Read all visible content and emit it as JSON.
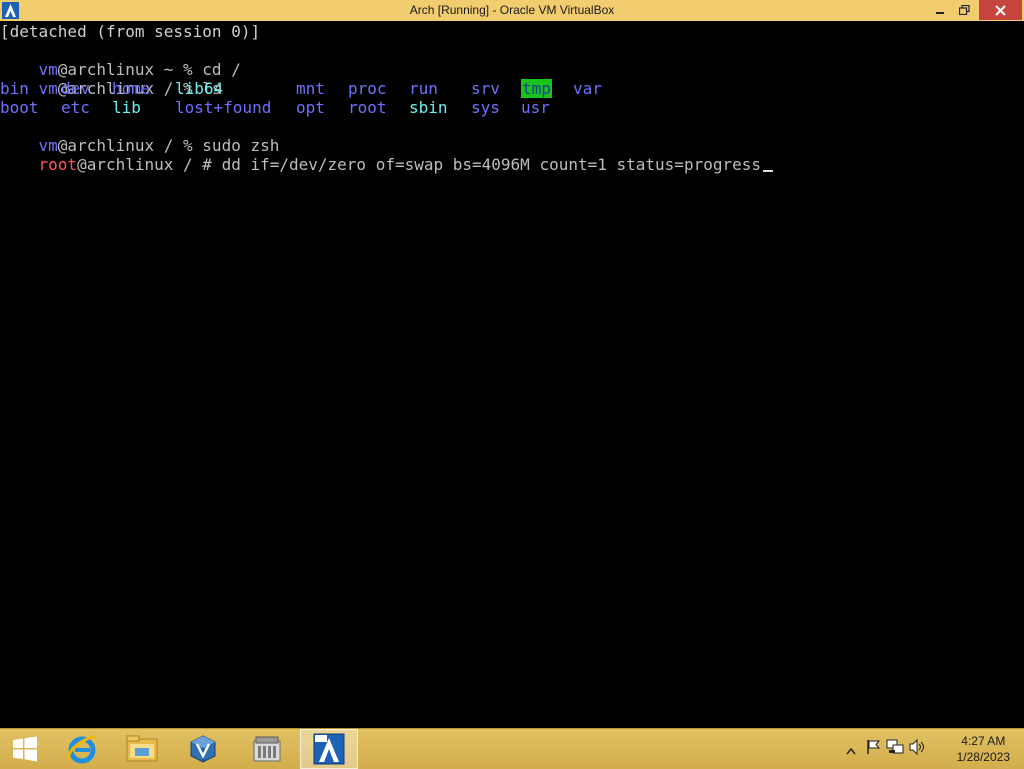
{
  "window": {
    "title": "Arch [Running] - Oracle VM VirtualBox",
    "accent_color": "#f2cd6f",
    "close_color": "#c7443e"
  },
  "terminal": {
    "line1": "[detached (from session 0)]",
    "line2": {
      "user": "vm",
      "host": "@archlinux",
      "path": " ~ % ",
      "cmd": "cd /"
    },
    "line3": {
      "user": "vm",
      "host": "@archlinux",
      "path": " / % ",
      "cmd": "ls"
    },
    "ls_row1": [
      "bin",
      "dev",
      "home",
      "lib64",
      "mnt",
      "proc",
      "run",
      "srv",
      "tmp",
      "var"
    ],
    "ls_row2": [
      "boot",
      "etc",
      "lib",
      "lost+found",
      "opt",
      "root",
      "sbin",
      "sys",
      "usr"
    ],
    "line6": {
      "user": "vm",
      "host": "@archlinux",
      "path": " / % ",
      "cmd": "sudo zsh"
    },
    "line7": {
      "user": "root",
      "host": "@archlinux",
      "path": " / # ",
      "cmd": "dd if=/dev/zero of=swap bs=4096M count=1 status=progress"
    }
  },
  "taskbar": {
    "items": [
      "start-icon",
      "internet-explorer-icon",
      "file-explorer-icon",
      "virtualbox-icon",
      "virtualbox-manager-icon",
      "arch-vm-icon"
    ],
    "active_item": "arch-vm-icon",
    "clock_time": "4:27 AM",
    "clock_date": "1/28/2023"
  }
}
